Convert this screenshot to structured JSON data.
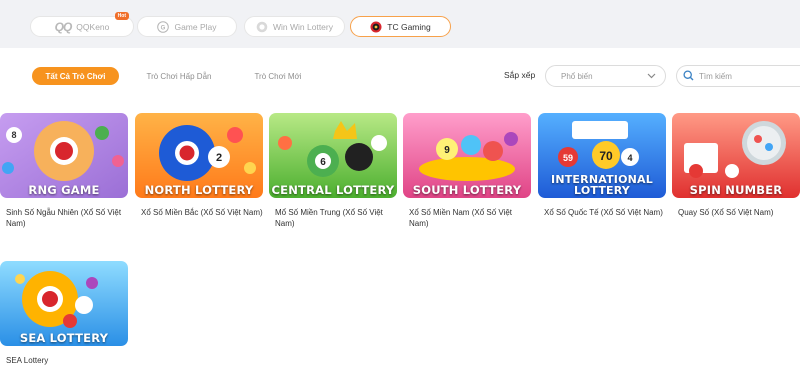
{
  "providers": [
    {
      "label": "QQKeno",
      "badge": "Hot",
      "logo": "QQ",
      "icon": "qq-logo-icon",
      "active": false
    },
    {
      "label": "Game Play",
      "icon": "gameplay-logo-icon",
      "active": false
    },
    {
      "label": "Win Win Lottery",
      "icon": "winwin-logo-icon",
      "active": false
    },
    {
      "label": "TC Gaming",
      "icon": "tc-gaming-logo-icon",
      "active": true
    }
  ],
  "categories": [
    {
      "label": "Tất Cả Trò Chơi",
      "active": true
    },
    {
      "label": "Trò Chơi Hấp Dẫn",
      "active": false
    },
    {
      "label": "Trò Chơi Mới",
      "active": false
    }
  ],
  "sort": {
    "label": "Sắp xếp",
    "value": "Phổ biến"
  },
  "search": {
    "placeholder": "Tìm kiếm"
  },
  "games": [
    {
      "banner": "RNG GAME",
      "name": "Sinh Số Ngẫu Nhiên (Xổ Số Việt Nam)",
      "bg": [
        "#b98be0",
        "#f2a45c"
      ]
    },
    {
      "banner": "NORTH LOTTERY",
      "name": "Xổ Số Miền Bắc (Xổ Số Việt Nam)",
      "bg": [
        "#ffb347",
        "#ff7a1a"
      ]
    },
    {
      "banner": "CENTRAL LOTTERY",
      "name": "Mổ Số Miền Trung (Xổ Số Việt Nam)",
      "bg": [
        "#a8e063",
        "#4caf2f"
      ]
    },
    {
      "banner": "SOUTH LOTTERY",
      "name": "Xổ Số Miền Nam (Xổ Số Việt Nam)",
      "bg": [
        "#ff86b8",
        "#e04486"
      ]
    },
    {
      "banner": "INTERNATIONAL LOTTERY",
      "name": "Xổ Số Quốc Tế (Xổ Số Việt Nam)",
      "bg": [
        "#4aa3ff",
        "#1e5bd6"
      ]
    },
    {
      "banner": "SPIN NUMBER",
      "name": "Quay Số (Xổ Số Việt Nam)",
      "bg": [
        "#ff8d7a",
        "#e0302f"
      ]
    },
    {
      "banner": "SEA LOTTERY",
      "name": "SEA Lottery",
      "bg": [
        "#7fd3ff",
        "#2a8fe6"
      ]
    }
  ]
}
